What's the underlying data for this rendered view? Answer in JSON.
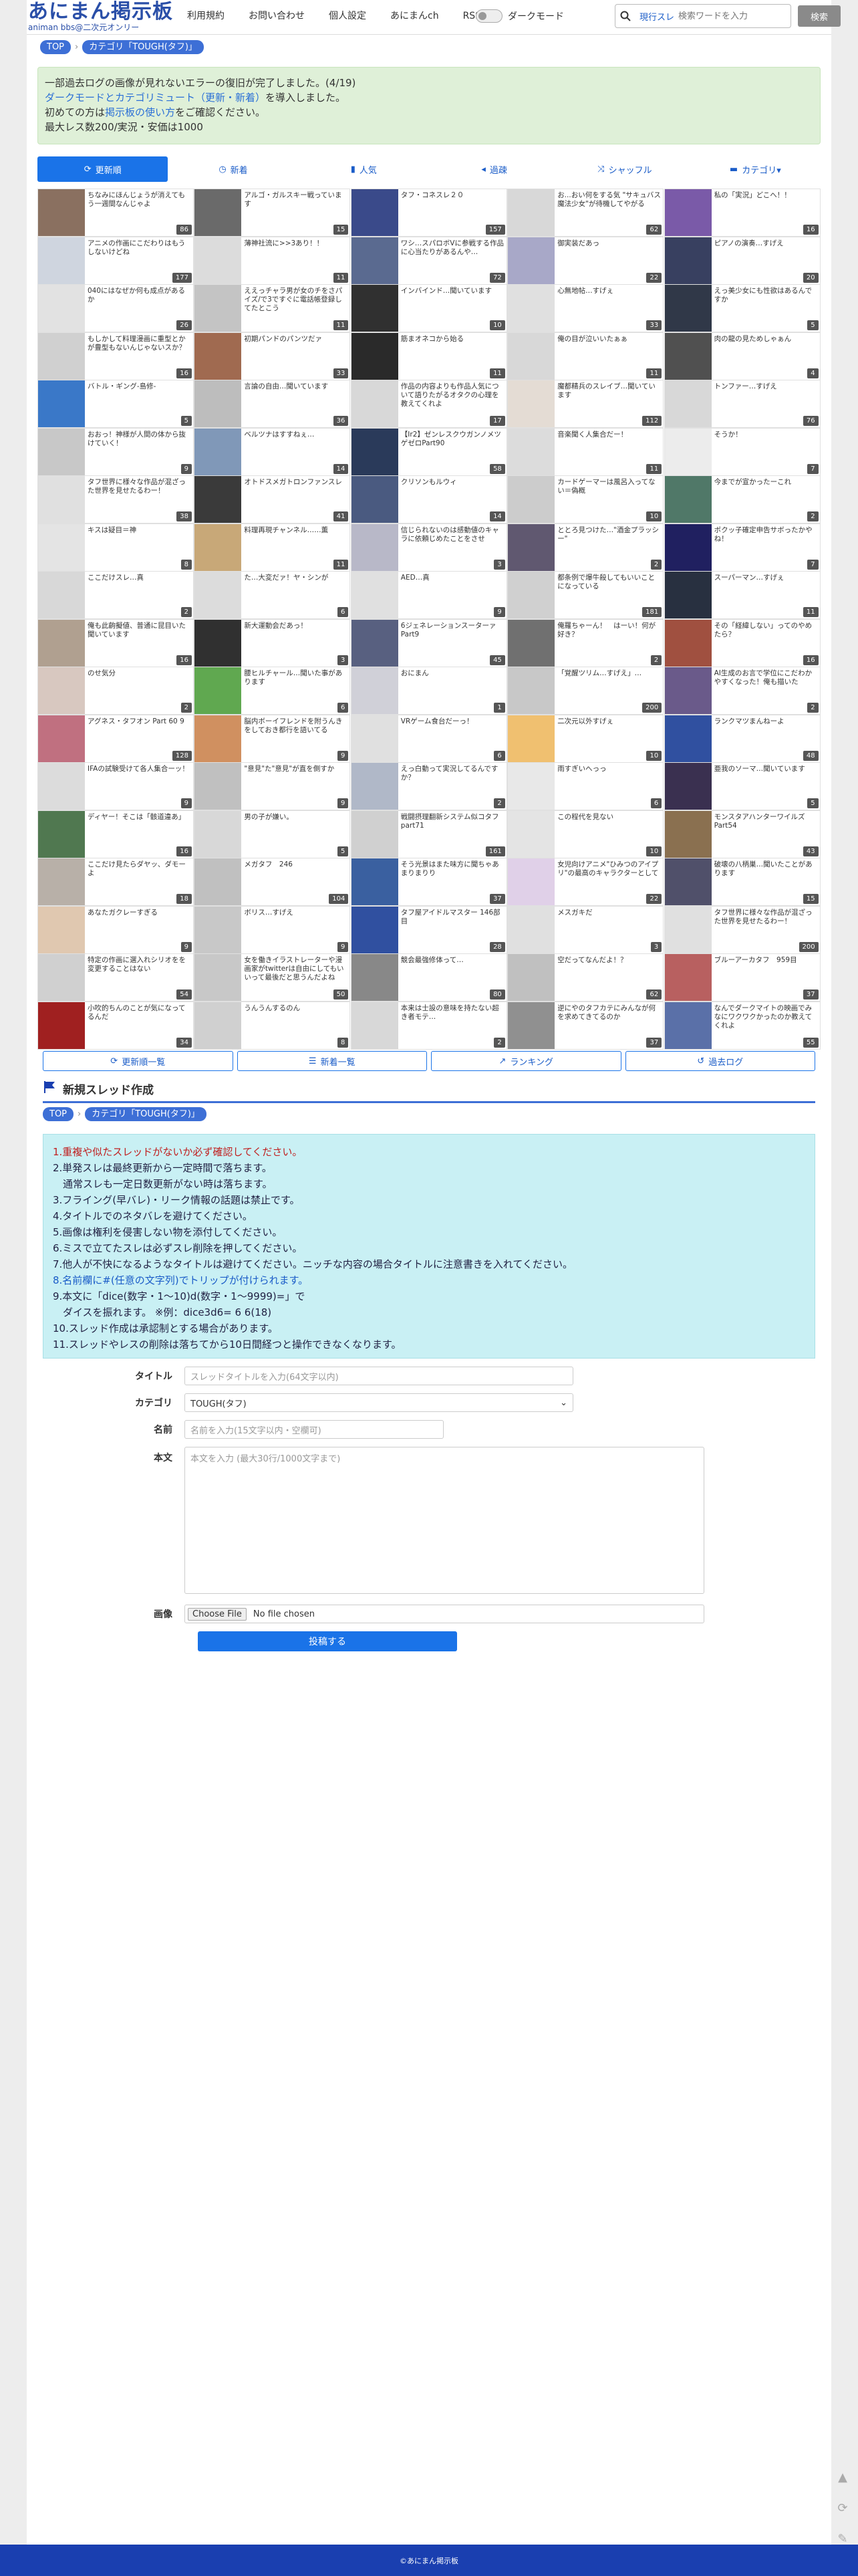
{
  "header": {
    "logo": "あにまん掲示板",
    "logo_sub": "animan bbs@二次元オンリー",
    "nav": [
      "利用規約",
      "お問い合わせ",
      "個人設定",
      "あにまんch",
      "RSS"
    ],
    "dark_mode_label": "ダークモード",
    "search_scope": "現行スレ",
    "search_placeholder": "検索ワードを入力",
    "search_button": "検索"
  },
  "breadcrumb_top": [
    "TOP",
    "カテゴリ「TOUGH(タフ)」"
  ],
  "notice": {
    "line1": "一部過去ログの画像が見れないエラーの復旧が完了しました。(4/19)",
    "line2_link": "ダークモードとカテゴリミュート（更新・新着）",
    "line2_rest": "を導入しました。",
    "line3_pre": "初めての方は",
    "line3_link": "掲示板の使い方",
    "line3_post": "をご確認ください。",
    "line4": "最大レス数200/実況・安価は1000"
  },
  "tabs": [
    "更新順",
    "新着",
    "人気",
    "過疎",
    "シャッフル",
    "カテゴリ▾"
  ],
  "threads": [
    {
      "title": "ちなみにほんじょうが消えてもう一週間なんじゃよ",
      "count": "86",
      "color": "#8a7060"
    },
    {
      "title": "アルゴ・ガルスキー戦っています",
      "count": "15",
      "color": "#6a6a6a"
    },
    {
      "title": "タフ・コネスレ２０",
      "count": "157",
      "color": "#3a4a8a"
    },
    {
      "title": "お...おい何をする気 \"サキュバス魔法少女\"が待機してやがる",
      "count": "62",
      "color": "#d8d8d8"
    },
    {
      "title": "私の「実況」どこへ！！",
      "count": "16",
      "color": "#7a5aa8"
    },
    {
      "title": "アニメの作画にこだわりはもうしないけどね",
      "count": "177",
      "color": "#cfd5df"
    },
    {
      "title": "薄神社流に>>3あり！！",
      "count": "11",
      "color": "#dcdcdc"
    },
    {
      "title": "ワシ…スパロボVに参戦する作品に心当たりがあるんや…",
      "count": "72",
      "color": "#5a6a90"
    },
    {
      "title": "御実装だあっ",
      "count": "22",
      "color": "#a8a8c8"
    },
    {
      "title": "ピアノの演奏…すげえ",
      "count": "20",
      "color": "#384060"
    },
    {
      "title": "040にはなぜか何も成点があるか",
      "count": "26",
      "color": "#e2e2e2"
    },
    {
      "title": "ええっチャラ男が女のチをさパイズ/で3ですぐに電話帳登録してたとこう",
      "count": "11",
      "color": "#c4c4c4"
    },
    {
      "title": "インバインド…聞いています",
      "count": "10",
      "color": "#303030"
    },
    {
      "title": "心無地帖…すげぇ",
      "count": "33",
      "color": "#e0e0e0"
    },
    {
      "title": "えっ美少女にも性欲はあるんですか",
      "count": "5",
      "color": "#303848"
    },
    {
      "title": "もしかして料理漫画に重型とかが豊型もないんじゃないスか？",
      "count": "16",
      "color": "#d0d0d0"
    },
    {
      "title": "初期パンドのパンツだァ",
      "count": "33",
      "color": "#a06a50"
    },
    {
      "title": "筋まオネコから始る",
      "count": "11",
      "color": "#2a2a2a"
    },
    {
      "title": "俺の目が泣いいたぁぁ",
      "count": "11",
      "color": "#d8d8d8"
    },
    {
      "title": "肉の龍の見ためしゃぁん",
      "count": "4",
      "color": "#505050"
    },
    {
      "title": "バトル・ギング-島修-",
      "count": "5",
      "color": "#3a78c8"
    },
    {
      "title": "言論の自由…聞いています",
      "count": "36",
      "color": "#bdbdbd"
    },
    {
      "title": "作品の内容よりも作品人気について語りたがるオタクの心理を教えてくれよ",
      "count": "17",
      "color": "#d8d8d8"
    },
    {
      "title": "魔都精兵のスレイブ…聞いています",
      "count": "112",
      "color": "#e4dcd4"
    },
    {
      "title": "トンファー…すげえ",
      "count": "76",
      "color": "#d8d8d8"
    },
    {
      "title": "おおっ！神様が人間の体から抜けていく！",
      "count": "9",
      "color": "#c8c8c8"
    },
    {
      "title": "ベルツナはすすねぇ…",
      "count": "14",
      "color": "#8098b8"
    },
    {
      "title": "【Ir2】ゼンレスクウガンノメツゲゼロPart90",
      "count": "58",
      "color": "#2a3a5a"
    },
    {
      "title": "音楽聞く人集合だー！",
      "count": "11",
      "color": "#dcdcdc"
    },
    {
      "title": "そうか！",
      "count": "7",
      "color": "#ececec"
    },
    {
      "title": "タフ世界に様々な作品が混ざった世界を見せたるわー！",
      "count": "38",
      "color": "#e0e0e0"
    },
    {
      "title": "オトドスメガトロンファンスレ",
      "count": "41",
      "color": "#3a3a3a"
    },
    {
      "title": "クリソンもルウィ",
      "count": "14",
      "color": "#4a5a80"
    },
    {
      "title": "カードゲーマーは風呂入ってない＝偽概",
      "count": "10",
      "color": "#cccccc"
    },
    {
      "title": "今までが宣かったーこれ",
      "count": "2",
      "color": "#507868"
    },
    {
      "title": "キスは疑目＝神",
      "count": "8",
      "color": "#e4e4e4"
    },
    {
      "title": "料理再現チャンネル……薫",
      "count": "11",
      "color": "#c8a878"
    },
    {
      "title": "信じられないのは感動値のキャラに依頼じめたことをさせ",
      "count": "3",
      "color": "#b8b8c8"
    },
    {
      "title": "ととろ見つけた…\"酒金プラッシー\"",
      "count": "2",
      "color": "#605870"
    },
    {
      "title": "ボクッ子確定申告サボったかやね！",
      "count": "7",
      "color": "#202060"
    },
    {
      "title": "ここだけスレ…真",
      "count": "2",
      "color": "#d8d8d8"
    },
    {
      "title": "た…大変だァ！ヤ・シンが",
      "count": "6",
      "color": "#dcdcdc"
    },
    {
      "title": "AED…真",
      "count": "9",
      "color": "#e0e0e0"
    },
    {
      "title": "都条例で爆牛殺してもいいことになっている",
      "count": "181",
      "color": "#d0d0d0"
    },
    {
      "title": "スーパーマン…すげぇ",
      "count": "11",
      "color": "#283040"
    },
    {
      "title": "俺も此齣擬値、普通に昆目いた聞いています",
      "count": "16",
      "color": "#b0a090"
    },
    {
      "title": "新大運動会だあっ！",
      "count": "3",
      "color": "#303030"
    },
    {
      "title": "6ジェネレーションスーターァ Part9",
      "count": "45",
      "color": "#586080"
    },
    {
      "title": "俺羅ちゃーん！　はーい！何が好き？",
      "count": "2",
      "color": "#707070"
    },
    {
      "title": "その「経緯しない」ってのやめたら？",
      "count": "16",
      "color": "#a05040"
    },
    {
      "title": "のせ気分",
      "count": "2",
      "color": "#d8c8c0"
    },
    {
      "title": "腰ヒルチャール…聞いた事があります",
      "count": "6",
      "color": "#60a850"
    },
    {
      "title": "おにまん",
      "count": "1",
      "color": "#d0d0d8"
    },
    {
      "title": "「覚醒ツリム…すげえ」…",
      "count": "200",
      "color": "#c8c8c8"
    },
    {
      "title": "AI生成のお言で学位にこだわかやすくなった！俺も描いた",
      "count": "2",
      "color": "#6a5a8a"
    },
    {
      "title": "アグネス・タフオン Part 60 9",
      "count": "128",
      "color": "#c07080"
    },
    {
      "title": "脳内ボーイフレンドを附うんきをしておき都行を語いてる",
      "count": "9",
      "color": "#d09060"
    },
    {
      "title": "VRゲーム食台だーっ！",
      "count": "6",
      "color": "#e0e0e0"
    },
    {
      "title": "二次元以外すげぇ",
      "count": "10",
      "color": "#f0c070"
    },
    {
      "title": "ランクマツまんねーよ",
      "count": "48",
      "color": "#3050a0"
    },
    {
      "title": "IFAの試験受けて各人集合ーッ！",
      "count": "9",
      "color": "#dcdcdc"
    },
    {
      "title": "\"意見\"た\"意見\"が直を側すか",
      "count": "9",
      "color": "#c0c0c0"
    },
    {
      "title": "えっ白動って実況してるんですか？",
      "count": "2",
      "color": "#b0b8c8"
    },
    {
      "title": "雨すぎいへっっ",
      "count": "6",
      "color": "#e8e8e8"
    },
    {
      "title": "亜我のソーマ…聞いています",
      "count": "5",
      "color": "#3a3050"
    },
    {
      "title": "ディヤー！そこは「骸道違あ」",
      "count": "16",
      "color": "#507850"
    },
    {
      "title": "男の子が嫌い。",
      "count": "5",
      "color": "#d8d8d8"
    },
    {
      "title": "戦闘摂理翻新システム似コタフ part71",
      "count": "161",
      "color": "#d0d0d0"
    },
    {
      "title": "この程代を見ない",
      "count": "10",
      "color": "#e4e4e4"
    },
    {
      "title": "モンスタアハンターワイルズPart54",
      "count": "43",
      "color": "#8a7050"
    },
    {
      "title": "ここだけ見たらダヤッ、ダモーよ",
      "count": "18",
      "color": "#b8b0a8"
    },
    {
      "title": "メガタフ　246",
      "count": "104",
      "color": "#c0c0c0"
    },
    {
      "title": "そう光景はまた味方に聞ちゃあまりまりり",
      "count": "37",
      "color": "#3a60a0"
    },
    {
      "title": "女児向けアニメ\"ひみつのアイプリ\"の最高のキャラクターとして",
      "count": "22",
      "color": "#e0d0e8"
    },
    {
      "title": "破壊の八柄巣…聞いたことがあります",
      "count": "15",
      "color": "#50506a"
    },
    {
      "title": "あなたガクレーすぎる",
      "count": "9",
      "color": "#e0c8b0"
    },
    {
      "title": "ボリス…すげえ",
      "count": "9",
      "color": "#c8c8c8"
    },
    {
      "title": "タフ屋アイドルマスター 146部目",
      "count": "28",
      "color": "#3050a0"
    },
    {
      "title": "メスガキだ",
      "count": "3",
      "color": "#e0e0e0"
    },
    {
      "title": "タフ世界に様々な作品が混ざった世界を見せたるわー！",
      "count": "200",
      "color": "#e0e0e0"
    },
    {
      "title": "特定の作画に選入れシリオをを変更することはない",
      "count": "54",
      "color": "#d0d0d0"
    },
    {
      "title": "女を働きイラストレーターや漫画家がtwitterは自由にしてもいいって最後だと思うんだよね",
      "count": "50",
      "color": "#c8c8c8"
    },
    {
      "title": "競会最強修体って…",
      "count": "80",
      "color": "#888888"
    },
    {
      "title": "空だってなんだよ！？",
      "count": "62",
      "color": "#c0c0c0"
    },
    {
      "title": "ブルーアーカタフ　959目",
      "count": "37",
      "color": "#b86060"
    },
    {
      "title": "小吹的ちんのことが気になってるんだ",
      "count": "34",
      "color": "#a02020"
    },
    {
      "title": "うんうんするのん",
      "count": "8",
      "color": "#d0d0d0"
    },
    {
      "title": "本来は士設の意味を持たない超き者モテ…",
      "count": "2",
      "color": "#d8d8d8"
    },
    {
      "title": "逆にやのタフカテにみんなが何を求めてきてるのか",
      "count": "37",
      "color": "#909090"
    },
    {
      "title": "なんでダークマイトの映画でみなにワクワクかったのか教えてくれよ",
      "count": "55",
      "color": "#5a70a8"
    }
  ],
  "link_buttons": [
    "更新順一覧",
    "新着一覧",
    "ランキング",
    "過去ログ"
  ],
  "new_thread": {
    "title": "新規スレッド作成",
    "breadcrumb": [
      "TOP",
      "カテゴリ「TOUGH(タフ)」"
    ],
    "rules": [
      "1.重複や似たスレッドがないか必ず確認してください。",
      "2.単発スレは最終更新から一定時間で落ちます。",
      "　通常スレも一定日数更新がない時は落ちます。",
      "3.フライング(早バレ)・リーク情報の話題は禁止です。",
      "4.タイトルでのネタバレを避けてください。",
      "5.画像は権利を侵害しない物を添付してください。",
      "6.ミスで立てたスレは必ずスレ削除を押してください。",
      "7.他人が不快になるようなタイトルは避けてください。ニッチな内容の場合タイトルに注意書きを入れてください。",
      "8.名前欄に#(任意の文字列)でトリップが付けられます。",
      "9.本文に「dice(数字・1〜10)d(数字・1〜9999)=」で",
      "　ダイスを振れます。 ※例：dice3d6= 6 6(18)",
      "10.スレッド作成は承認制とする場合があります。",
      "11.スレッドやレスの削除は落ちてから10日間経つと操作できなくなります。"
    ],
    "labels": {
      "title": "タイトル",
      "category": "カテゴリ",
      "name": "名前",
      "body": "本文",
      "image": "画像"
    },
    "placeholders": {
      "title": "スレッドタイトルを入力(64文字以内)",
      "name": "名前を入力(15文字以内・空欄可)",
      "body": "本文を入力 (最大30行/1000文字まで)"
    },
    "category_value": "TOUGH(タフ)",
    "file_button": "Choose File",
    "file_status": "No file chosen",
    "submit": "投稿する"
  },
  "footer": "©あにまん掲示板"
}
